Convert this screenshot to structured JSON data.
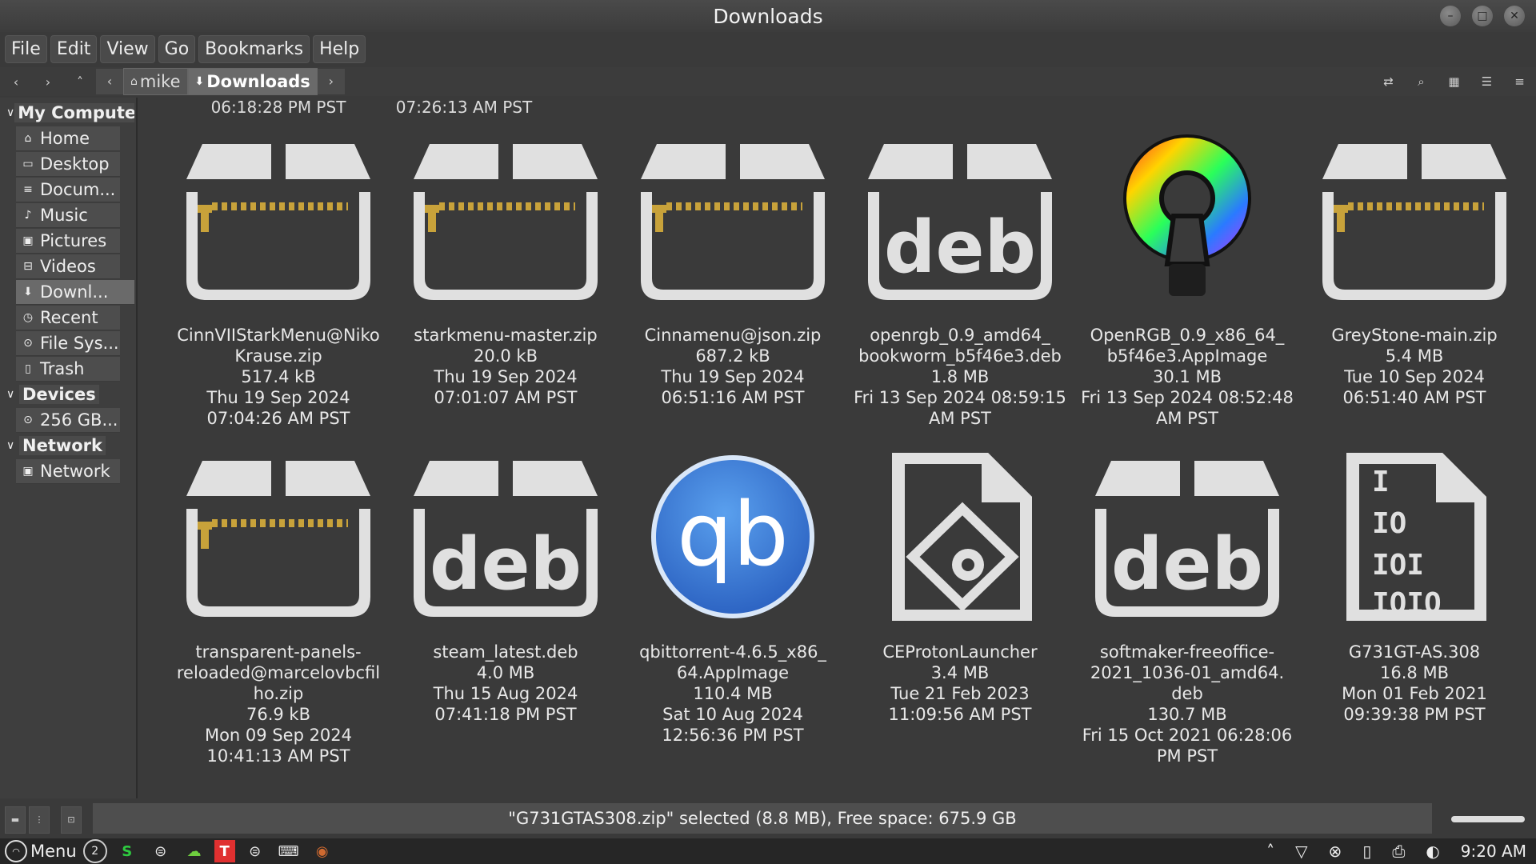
{
  "window": {
    "title": "Downloads",
    "controls": [
      "minimize-icon",
      "maximize-icon",
      "close-icon"
    ]
  },
  "menubar": [
    "File",
    "Edit",
    "View",
    "Go",
    "Bookmarks",
    "Help"
  ],
  "toolbar": {
    "breadcrumbs": [
      {
        "label": "mike",
        "icon": "home-icon"
      },
      {
        "label": "Downloads",
        "icon": "download-icon"
      }
    ]
  },
  "sidebar": {
    "sections": [
      {
        "label": "My Computer",
        "items": [
          {
            "label": "Home",
            "icon": "home-icon"
          },
          {
            "label": "Desktop",
            "icon": "desktop-icon"
          },
          {
            "label": "Docum...",
            "icon": "documents-icon"
          },
          {
            "label": "Music",
            "icon": "music-icon"
          },
          {
            "label": "Pictures",
            "icon": "pictures-icon"
          },
          {
            "label": "Videos",
            "icon": "videos-icon"
          },
          {
            "label": "Downl...",
            "icon": "downloads-icon",
            "selected": true
          },
          {
            "label": "Recent",
            "icon": "recent-icon"
          },
          {
            "label": "File Sys...",
            "icon": "filesystem-icon"
          },
          {
            "label": "Trash",
            "icon": "trash-icon"
          }
        ]
      },
      {
        "label": "Devices",
        "items": [
          {
            "label": "256 GB...",
            "icon": "drive-icon"
          }
        ]
      },
      {
        "label": "Network",
        "items": [
          {
            "label": "Network",
            "icon": "network-icon"
          }
        ]
      }
    ]
  },
  "top_partial_row": [
    {
      "time": "06:18:28 PM PST"
    },
    {
      "time": "07:26:13 AM PST"
    }
  ],
  "files": [
    {
      "name": "CinnVIIStarkMenu@NikoKrause.zip",
      "lines": [
        "CinnVIIStarkMenu@Niko",
        "Krause.zip",
        "517.4 kB",
        "Thu 19 Sep 2024",
        "07:04:26 AM PST"
      ],
      "type": "zip"
    },
    {
      "name": "starkmenu-master.zip",
      "lines": [
        "starkmenu-master.zip",
        "20.0 kB",
        "Thu 19 Sep 2024",
        "07:01:07 AM PST"
      ],
      "type": "zip"
    },
    {
      "name": "Cinnamenu@json.zip",
      "lines": [
        "Cinnamenu@json.zip",
        "687.2 kB",
        "Thu 19 Sep 2024",
        "06:51:16 AM PST"
      ],
      "type": "zip"
    },
    {
      "name": "openrgb_0.9_amd64_bookworm_b5f46e3.deb",
      "lines": [
        "openrgb_0.9_amd64_",
        "bookworm_b5f46e3.deb",
        "1.8 MB",
        "Fri 13 Sep 2024 08:59:15",
        "AM PST"
      ],
      "type": "deb"
    },
    {
      "name": "OpenRGB_0.9_x86_64_b5f46e3.AppImage",
      "lines": [
        "OpenRGB_0.9_x86_64_",
        "b5f46e3.AppImage",
        "30.1 MB",
        "Fri 13 Sep 2024 08:52:48",
        "AM PST"
      ],
      "type": "openrgb"
    },
    {
      "name": "GreyStone-main.zip",
      "lines": [
        "GreyStone-main.zip",
        "5.4 MB",
        "Tue 10 Sep 2024",
        "06:51:40 AM PST"
      ],
      "type": "zip"
    },
    {
      "name": "transparent-panels-reloaded@marcelovbcfilho.zip",
      "lines": [
        "transparent-panels-",
        "reloaded@marcelovbcfil",
        "ho.zip",
        "76.9 kB",
        "Mon 09 Sep 2024",
        "10:41:13 AM PST"
      ],
      "type": "zip"
    },
    {
      "name": "steam_latest.deb",
      "lines": [
        "steam_latest.deb",
        "4.0 MB",
        "Thu 15 Aug 2024",
        "07:41:18 PM PST"
      ],
      "type": "deb"
    },
    {
      "name": "qbittorrent-4.6.5_x86_64.AppImage",
      "lines": [
        "qbittorrent-4.6.5_x86_",
        "64.AppImage",
        "110.4 MB",
        "Sat 10 Aug 2024",
        "12:56:36 PM PST"
      ],
      "type": "qb"
    },
    {
      "name": "CEProtonLauncher",
      "lines": [
        "CEProtonLauncher",
        "3.4 MB",
        "Tue 21 Feb 2023",
        "11:09:56 AM PST"
      ],
      "type": "exec"
    },
    {
      "name": "softmaker-freeoffice-2021_1036-01_amd64.deb",
      "lines": [
        "softmaker-freeoffice-",
        "2021_1036-01_amd64.",
        "deb",
        "130.7 MB",
        "Fri 15 Oct 2021 06:28:06",
        "PM PST"
      ],
      "type": "deb"
    },
    {
      "name": "G731GT-AS.308",
      "lines": [
        "G731GT-AS.308",
        "16.8 MB",
        "Mon 01 Feb 2021",
        "09:39:38 PM PST"
      ],
      "type": "binary"
    }
  ],
  "status": {
    "text": "\"G731GTAS308.zip\" selected (8.8 MB), Free space: 675.9 GB"
  },
  "panel": {
    "menu_label": "Menu",
    "workspace": "2",
    "clock": "9:20 AM",
    "launchers": [
      "workspace-icon",
      "s-app-icon",
      "app-icon",
      "cloud-icon",
      "t-app-icon",
      "app2-icon",
      "terminal-icon",
      "app3-icon"
    ],
    "tray": [
      "chevron-up-icon",
      "vpn-icon",
      "network-icon",
      "clipboard-icon",
      "printer-icon",
      "display-icon"
    ]
  },
  "colors": {
    "background": "#3a3a3a",
    "zip_accent": "#c8a23a",
    "qb_blue": "#3b78d0"
  }
}
